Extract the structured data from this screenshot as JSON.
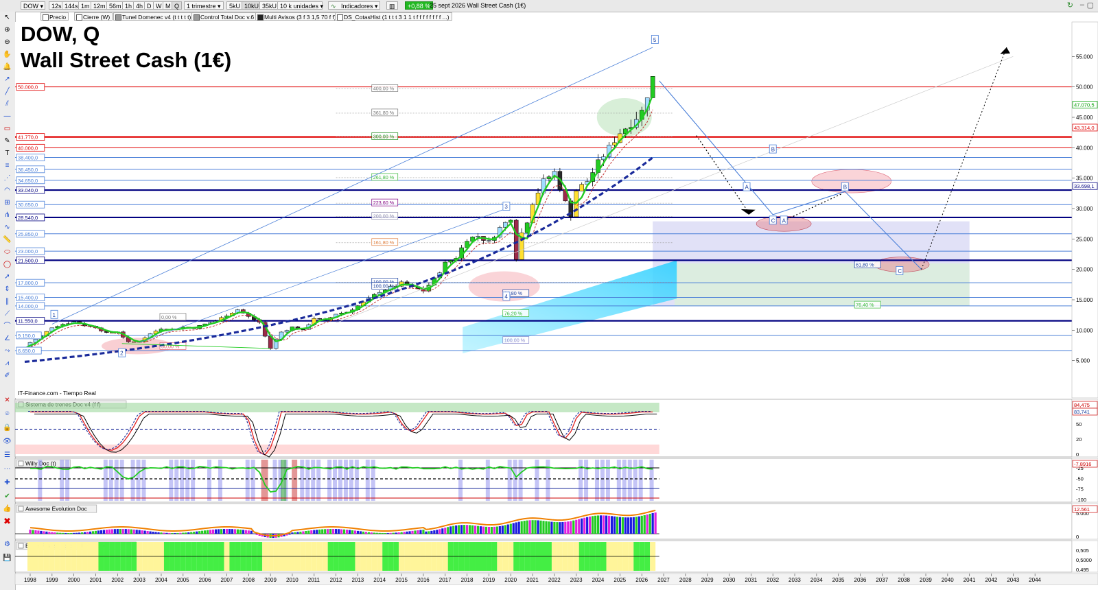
{
  "toolbar": {
    "symbol": "DOW",
    "timeframes": [
      "12s",
      "144s",
      "1m",
      "12m",
      "56m",
      "1h",
      "4h",
      "D",
      "W",
      "M",
      "Q"
    ],
    "period": "1 trimestre",
    "units": [
      "5kU",
      "10kU",
      "35kU"
    ],
    "size": "10 k unidades",
    "indicators_label": "Indicadores",
    "change": "+0,88 %",
    "date_instrument": "25 sept 2026 Wall Street Cash (1€)"
  },
  "indicator_tags": [
    "Precio",
    "Cierre (W)",
    "Tunel Domenec v4 (t t t t t)",
    "Control Total Doc v.6",
    "Multi Avisos (3 f 3 1,5 70 f f)",
    "DS_CotasHist (1 t t t 3 1 1 t f f f f f f f f ...)"
  ],
  "title": {
    "line1": "DOW, Q",
    "line2": "Wall Street Cash (1€)"
  },
  "source": "IT-Finance.com - Tiempo Real",
  "colors": {
    "accent_green": "#00c000",
    "red_level": "#e00000",
    "navy_level": "#000080",
    "blue_level": "#4a7fd8",
    "projection_box": "#c8c8f0",
    "cyan_zone": "#80e0ff"
  },
  "chart_data": {
    "type": "candlestick",
    "x_ticks": [
      "1998",
      "1999",
      "2000",
      "2001",
      "2002",
      "2003",
      "2004",
      "2005",
      "2006",
      "2007",
      "2008",
      "2009",
      "2010",
      "2011",
      "2012",
      "2013",
      "2014",
      "2015",
      "2016",
      "2017",
      "2018",
      "2019",
      "2020",
      "2021",
      "2022",
      "2023",
      "2024",
      "2025",
      "2026",
      "2027",
      "2028",
      "2029",
      "2030",
      "2031",
      "2032",
      "2033",
      "2034",
      "2035",
      "2036",
      "2037",
      "2038",
      "2039",
      "2040",
      "2041",
      "2042",
      "2043",
      "2044"
    ],
    "y_ticks": [
      5000,
      10000,
      15000,
      20000,
      25000,
      30000,
      35000,
      40000,
      45000,
      50000,
      55000
    ],
    "y_tick_labels": [
      "5.000",
      "10.000",
      "15.000",
      "20.000",
      "25.000",
      "30.000",
      "35.000",
      "40.000",
      "45.000",
      "50.000",
      "55.000"
    ],
    "ylim": [
      0,
      60000
    ],
    "xlim": [
      1997.5,
      2045
    ],
    "price_path": [
      [
        1997.75,
        7000
      ],
      [
        1998.0,
        8000
      ],
      [
        1998.5,
        9000
      ],
      [
        1999.0,
        10500
      ],
      [
        1999.5,
        11000
      ],
      [
        2000.0,
        11400
      ],
      [
        2000.5,
        10800
      ],
      [
        2001.0,
        10500
      ],
      [
        2001.5,
        9500
      ],
      [
        2002.0,
        9800
      ],
      [
        2002.5,
        8000
      ],
      [
        2003.0,
        8200
      ],
      [
        2003.5,
        9400
      ],
      [
        2004.0,
        10300
      ],
      [
        2004.5,
        10100
      ],
      [
        2005.0,
        10500
      ],
      [
        2005.5,
        10400
      ],
      [
        2006.0,
        11000
      ],
      [
        2006.5,
        11500
      ],
      [
        2007.0,
        12500
      ],
      [
        2007.5,
        13400
      ],
      [
        2008.0,
        12200
      ],
      [
        2008.5,
        11300
      ],
      [
        2008.75,
        9000
      ],
      [
        2009.0,
        7000
      ],
      [
        2009.25,
        8500
      ],
      [
        2009.5,
        9700
      ],
      [
        2010.0,
        10500
      ],
      [
        2010.5,
        10000
      ],
      [
        2011.0,
        12000
      ],
      [
        2011.5,
        11500
      ],
      [
        2012.0,
        12700
      ],
      [
        2012.5,
        13000
      ],
      [
        2013.0,
        14000
      ],
      [
        2013.5,
        15100
      ],
      [
        2014.0,
        16400
      ],
      [
        2014.5,
        17000
      ],
      [
        2015.0,
        17700
      ],
      [
        2015.5,
        17000
      ],
      [
        2016.0,
        16500
      ],
      [
        2016.5,
        18400
      ],
      [
        2017.0,
        21000
      ],
      [
        2017.5,
        22000
      ],
      [
        2018.0,
        25000
      ],
      [
        2018.5,
        25500
      ],
      [
        2019.0,
        24500
      ],
      [
        2019.5,
        26800
      ],
      [
        2020.0,
        28500
      ],
      [
        2020.25,
        21900
      ],
      [
        2020.5,
        26000
      ],
      [
        2020.75,
        28000
      ],
      [
        2021.0,
        31000
      ],
      [
        2021.5,
        34500
      ],
      [
        2022.0,
        36000
      ],
      [
        2022.5,
        31000
      ],
      [
        2022.75,
        29000
      ],
      [
        2023.0,
        33000
      ],
      [
        2023.5,
        34500
      ],
      [
        2024.0,
        37500
      ],
      [
        2024.5,
        40000
      ],
      [
        2025.0,
        42500
      ],
      [
        2025.5,
        44000
      ],
      [
        2026.0,
        46000
      ],
      [
        2026.5,
        51500
      ],
      [
        2026.7,
        51000
      ]
    ],
    "levels": [
      {
        "value": 50000,
        "label": "50.000,0",
        "color": "#e00000",
        "weight": "thin"
      },
      {
        "value": 41770,
        "label": "41.770,0",
        "color": "#e00000",
        "weight": "thick"
      },
      {
        "value": 40000,
        "label": "40.000,0",
        "color": "#e00000",
        "weight": "thin"
      },
      {
        "value": 38400,
        "label": "38.400,0",
        "color": "#4a7fd8",
        "weight": "thin"
      },
      {
        "value": 36450,
        "label": "36.450,0",
        "color": "#4a7fd8",
        "weight": "thin"
      },
      {
        "value": 34650,
        "label": "34.650,0",
        "color": "#4a7fd8",
        "weight": "thin"
      },
      {
        "value": 33040,
        "label": "33.040,0",
        "color": "#000080",
        "weight": "thick"
      },
      {
        "value": 30650,
        "label": "30.650,0",
        "color": "#4a7fd8",
        "weight": "thin"
      },
      {
        "value": 28540,
        "label": "28.540,0",
        "color": "#000080",
        "weight": "thick"
      },
      {
        "value": 25850,
        "label": "25.850,0",
        "color": "#4a7fd8",
        "weight": "thin"
      },
      {
        "value": 23000,
        "label": "23.000,0",
        "color": "#4a7fd8",
        "weight": "thin"
      },
      {
        "value": 21500,
        "label": "21.500,0",
        "color": "#000080",
        "weight": "thick"
      },
      {
        "value": 17800,
        "label": "17.800,0",
        "color": "#4a7fd8",
        "weight": "thin"
      },
      {
        "value": 15400,
        "label": "15.400,0",
        "color": "#4a7fd8",
        "weight": "thin"
      },
      {
        "value": 14000,
        "label": "14.000,0",
        "color": "#4a7fd8",
        "weight": "thin"
      },
      {
        "value": 11550,
        "label": "11.550,0",
        "color": "#000080",
        "weight": "thick"
      },
      {
        "value": 9150,
        "label": "9.150,0",
        "color": "#4a7fd8",
        "weight": "thin"
      },
      {
        "value": 6650,
        "label": "6.650,0",
        "color": "#4a7fd8",
        "weight": "thin"
      }
    ],
    "right_price_tags": [
      {
        "value": 47070,
        "label": "47.070,5",
        "color": "#00a000"
      },
      {
        "value": 43314,
        "label": "43.314,0",
        "color": "#e00000"
      },
      {
        "value": 33698,
        "label": "33.698,1",
        "color": "#000080"
      }
    ],
    "fib_labels": [
      {
        "text": "400,00 %",
        "value": 49800
      },
      {
        "text": "361,80 %",
        "value": 45800
      },
      {
        "text": "300,00 %",
        "value": 41900
      },
      {
        "text": "261,80 %",
        "value": 35200
      },
      {
        "text": "223,60 %",
        "value": 31000
      },
      {
        "text": "200,00 %",
        "value": 28800
      },
      {
        "text": "161,80 %",
        "value": 24500
      },
      {
        "text": "100,00 %",
        "value": 18000
      },
      {
        "text": "0,00 %",
        "value": 12200
      },
      {
        "text": "50,00 %",
        "value": 7400
      },
      {
        "text": "61,80 %",
        "value": 20800
      },
      {
        "text": "76,40 %",
        "value": 14200
      },
      {
        "text": "76,20 %",
        "value": 12800
      },
      {
        "text": "100,00 %",
        "value": 8400
      },
      {
        "text": "61,80 %",
        "value": 16100
      },
      {
        "text": "100,00 %",
        "value": 17300
      }
    ],
    "wave_labels": [
      "1",
      "2",
      "3",
      "4",
      "5",
      "A",
      "B",
      "C",
      "A",
      "B",
      "C"
    ],
    "projection_path": [
      [
        2026.8,
        51000
      ],
      [
        2032.0,
        29000
      ],
      [
        2035.3,
        32800
      ],
      [
        2038.8,
        20000
      ]
    ],
    "panels": [
      {
        "name": "Sistema de trenes Doc v4 (f f)",
        "y_ticks": [
          "80",
          "50",
          "20",
          "0"
        ],
        "values": [
          "84,475",
          "83,741"
        ]
      },
      {
        "name": "Willy Doc (t)",
        "y_ticks": [
          "-25",
          "-50",
          "-75",
          "-100"
        ],
        "values": [
          "-7,8916"
        ]
      },
      {
        "name": "Awesome Evolution Doc",
        "y_ticks": [
          "5.000",
          "0"
        ],
        "values": [
          "12.561"
        ]
      },
      {
        "name": "Barra Fuerza Fondo Mercado v4 (f)",
        "y_ticks": [
          "0,505",
          "0,5000",
          "0,495"
        ],
        "values": []
      }
    ]
  }
}
